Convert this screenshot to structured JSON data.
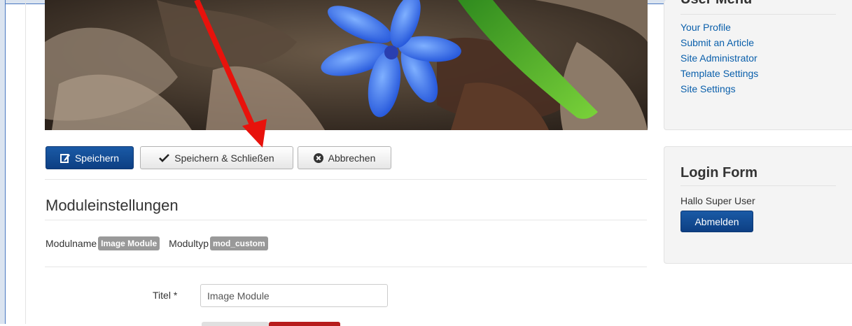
{
  "toolbar": {
    "save_label": "Speichern",
    "save_close_label": "Speichern & Schließen",
    "cancel_label": "Abbrechen"
  },
  "module_settings": {
    "title": "Moduleinstellungen",
    "module_name_label": "Modulname",
    "module_name_value": "Image Module",
    "module_type_label": "Modultyp",
    "module_type_value": "mod_custom"
  },
  "form": {
    "title_label": "Titel *",
    "title_value": "Image Module"
  },
  "user_menu": {
    "title": "User Menu",
    "items": [
      "Your Profile",
      "Submit an Article",
      "Site Administrator",
      "Template Settings",
      "Site Settings"
    ]
  },
  "login_form": {
    "title": "Login Form",
    "greeting": "Hallo Super User",
    "logout_label": "Abmelden"
  },
  "colors": {
    "primary_button": "#0d3f83",
    "link": "#0a5fab",
    "badge": "#999999",
    "annotation_arrow": "#e8120c"
  },
  "icons": {
    "save": "edit-icon",
    "save_close": "checkmark-icon",
    "cancel": "cancel-circle-icon"
  }
}
